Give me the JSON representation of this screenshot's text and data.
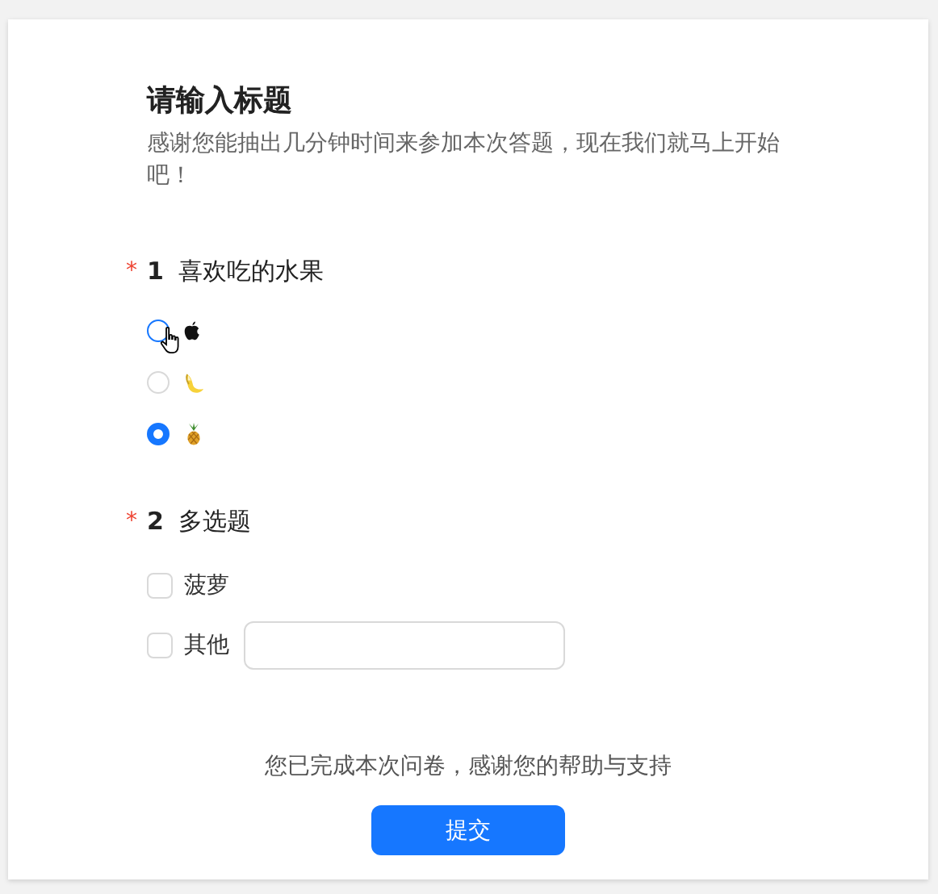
{
  "survey": {
    "title": "请输入标题",
    "description": "感谢您能抽出几分钟时间来参加本次答题，现在我们就马上开始吧！"
  },
  "questions": [
    {
      "kind": "radio",
      "required_mark": "*",
      "number": "1",
      "title": "喜欢吃的水果",
      "options": [
        {
          "kind": "apple",
          "selected": false,
          "hovered": true
        },
        {
          "kind": "banana",
          "selected": false,
          "hovered": false
        },
        {
          "kind": "pineapple",
          "selected": true,
          "hovered": false
        }
      ]
    },
    {
      "kind": "checkbox",
      "required_mark": "*",
      "number": "2",
      "title": "多选题",
      "options": [
        {
          "kind": "text",
          "label": "菠萝",
          "checked": false
        },
        {
          "kind": "text_with_field",
          "label": "其他",
          "checked": false
        }
      ]
    }
  ],
  "footer": {
    "message": "您已完成本次问卷，感谢您的帮助与支持",
    "submit": "提交"
  }
}
